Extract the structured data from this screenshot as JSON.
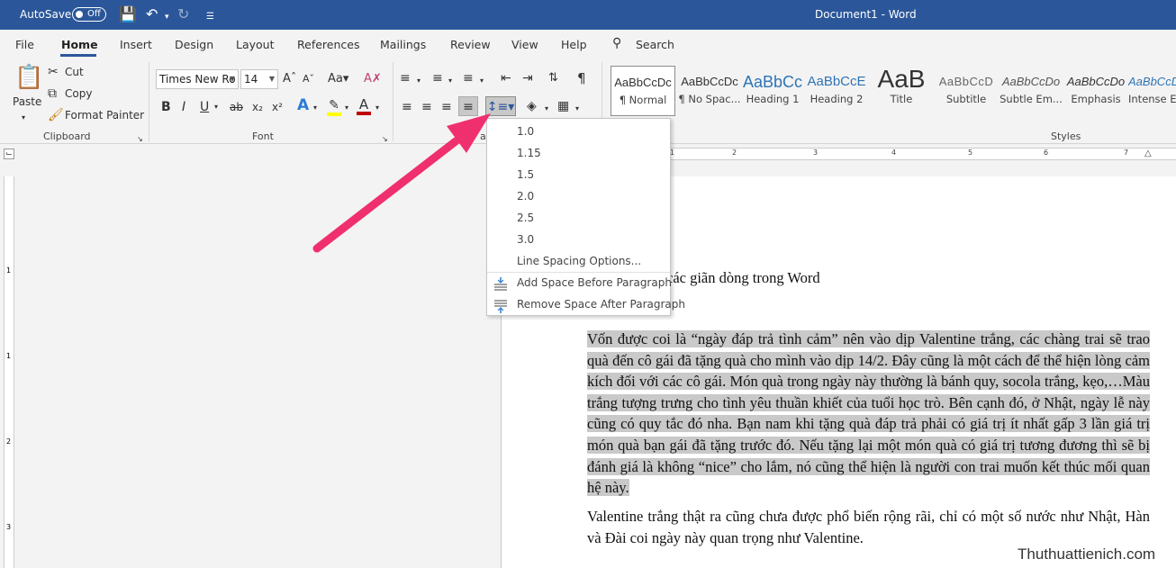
{
  "titlebar": {
    "autosave_label": "AutoSave",
    "autosave_state": "Off",
    "document_title": "Document1 - Word",
    "color": "#2b579a"
  },
  "tabs": [
    {
      "label": "File"
    },
    {
      "label": "Home",
      "active": true
    },
    {
      "label": "Insert"
    },
    {
      "label": "Design"
    },
    {
      "label": "Layout"
    },
    {
      "label": "References"
    },
    {
      "label": "Mailings"
    },
    {
      "label": "Review"
    },
    {
      "label": "View"
    },
    {
      "label": "Help"
    }
  ],
  "search_label": "Search",
  "clipboard": {
    "paste": "Paste",
    "cut": "Cut",
    "copy": "Copy",
    "format_painter": "Format Painter",
    "group_label": "Clipboard"
  },
  "font": {
    "family": "Times New Ro",
    "size": "14",
    "group_label": "Font",
    "font_color": "#c00000",
    "highlight_color": "#ffff00"
  },
  "paragraph": {
    "group_label_fragment": "ag"
  },
  "styles": {
    "group_label": "Styles",
    "items": [
      {
        "preview": "AaBbCcDc",
        "name": "¶ Normal",
        "selected": true
      },
      {
        "preview": "AaBbCcDc",
        "name": "¶ No Spac..."
      },
      {
        "preview": "AaBbCc",
        "name": "Heading 1"
      },
      {
        "preview": "AaBbCcE",
        "name": "Heading 2"
      },
      {
        "preview": "AaB",
        "name": "Title"
      },
      {
        "preview": "AaBbCcD",
        "name": "Subtitle"
      },
      {
        "preview": "AaBbCcDo",
        "name": "Subtle Em..."
      },
      {
        "preview": "AaBbCcDo",
        "name": "Emphasis"
      },
      {
        "preview": "AaBbCcDo",
        "name": "Intense E"
      }
    ]
  },
  "line_spacing_menu": {
    "options": [
      "1.0",
      "1.15",
      "1.5",
      "2.0",
      "2.5",
      "3.0"
    ],
    "line_spacing_options": "Line Spacing Options...",
    "add_space_before": "Add Space Before Paragraph",
    "remove_space_after": "Remove Space After Paragraph"
  },
  "document": {
    "heading_fragment": "các giãn dòng trong Word",
    "paragraph1": "Vốn được coi là “ngày đáp trả tình cảm” nên vào dịp Valentine trắng, các chàng trai sẽ trao quà đến cô gái đã tặng quà cho mình vào dịp 14/2. Đây cũng là một cách để thể hiện lòng cảm kích đối với các cô gái. Món quà trong ngày này thường là bánh quy, socola trắng, kẹo,…Màu trắng tượng trưng cho tình yêu thuần khiết của tuổi học trò. Bên cạnh đó, ở Nhật, ngày lễ này cũng có quy tắc đó nha. Bạn nam khi tặng quà đáp trả phải có giá trị ít nhất gấp 3 lần giá trị món quà bạn gái đã tặng trước đó. Nếu tặng lại một món quà có giá trị tương đương thì sẽ bị đánh giá là không “nice” cho lắm, nó cũng thể hiện là người con trai muốn kết thúc mối quan hệ này.",
    "paragraph2": "Valentine trắng thật ra cũng chưa được phổ biến rộng rãi, chỉ có một số nước như Nhật, Hàn và Đài coi ngày này quan trọng như Valentine."
  },
  "watermark": "Thuthuattienich.com",
  "annotation_arrow_color": "#f0306e"
}
